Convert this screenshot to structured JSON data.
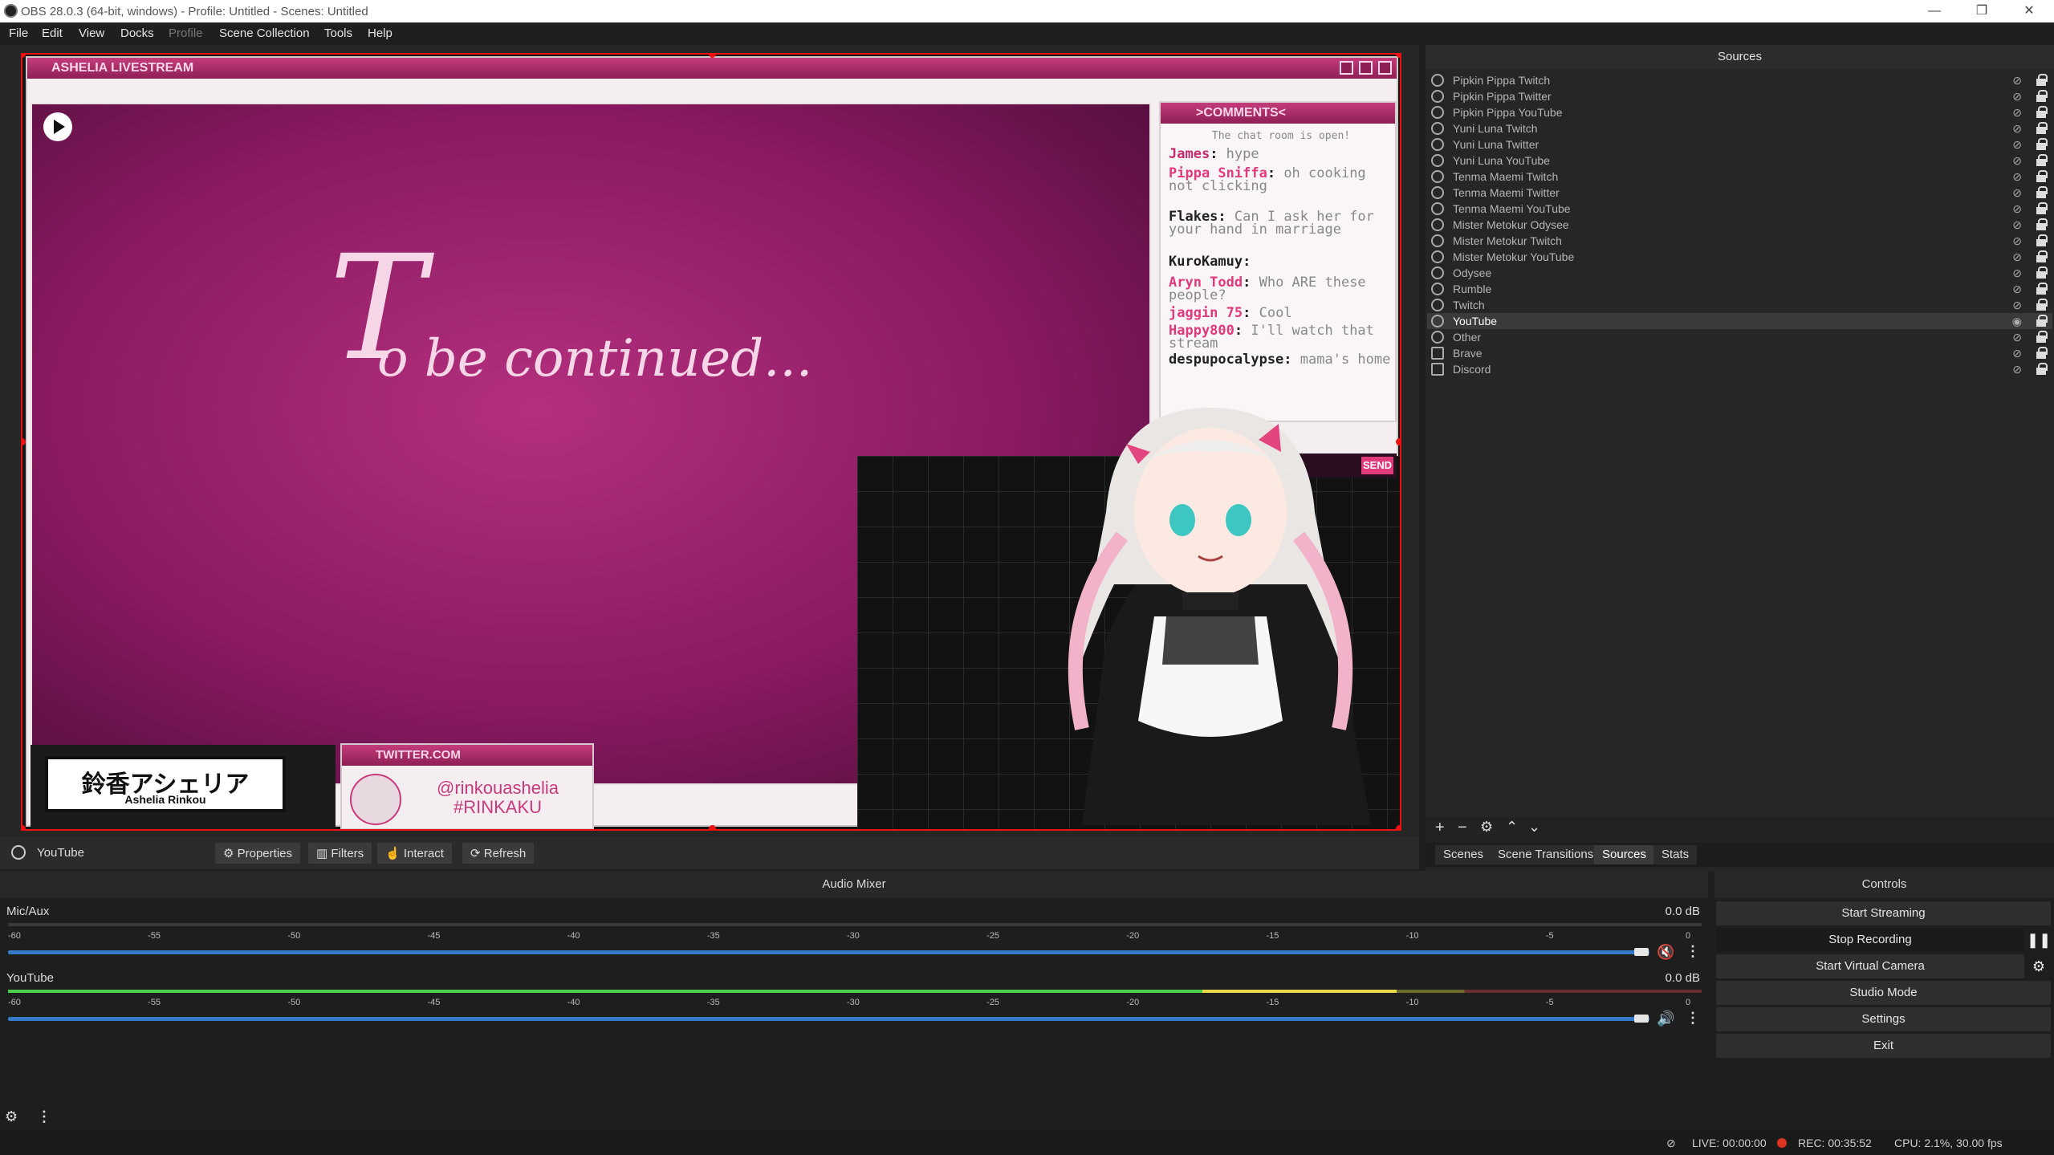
{
  "window": {
    "title": "OBS 28.0.3 (64-bit, windows) - Profile: Untitled - Scenes: Untitled",
    "minimize": "—",
    "maximize": "❐",
    "close": "✕"
  },
  "menu": [
    "File",
    "Edit",
    "View",
    "Docks",
    "Profile",
    "Scene Collection",
    "Tools",
    "Help"
  ],
  "preview": {
    "stream_title": "ASHELIA LIVESTREAM",
    "to_be_continued": "o be continued...",
    "big_letter": "T",
    "comments_title": ">COMMENTS<",
    "comments_notice": "The chat room is open!",
    "comments": [
      {
        "user": "James",
        "text": "hype"
      },
      {
        "user": "Pippa Sniffa",
        "text": "oh cooking not clicking"
      },
      {
        "user": "Flakes",
        "text": "Can I ask her for your hand in marriage"
      },
      {
        "user": "KuroKamuy",
        "text": ""
      },
      {
        "user": "Aryn Todd",
        "text": "Who ARE these people?"
      },
      {
        "user": "jaggin 75",
        "text": "Cool"
      },
      {
        "user": "Happy800",
        "text": "I'll watch that stream"
      },
      {
        "user": "despupocalypse",
        "text": "mama's home"
      }
    ],
    "send_label": "SEND",
    "logo_text": "鈴香アシェリア",
    "logo_sub": "Ashelia Rinkou",
    "twitter_title": "TWITTER.COM",
    "twitter_handle": "@rinkouashelia",
    "twitter_tag": "#RINKAKU"
  },
  "source_toolbar": {
    "selected_source": "YouTube",
    "properties": "Properties",
    "filters": "Filters",
    "interact": "Interact",
    "refresh": "Refresh"
  },
  "sources": {
    "title": "Sources",
    "items": [
      {
        "label": "Pipkin Pippa Twitch",
        "type": "browser"
      },
      {
        "label": "Pipkin Pippa Twitter",
        "type": "browser"
      },
      {
        "label": "Pipkin Pippa YouTube",
        "type": "browser"
      },
      {
        "label": "Yuni Luna Twitch",
        "type": "browser"
      },
      {
        "label": "Yuni Luna Twitter",
        "type": "browser"
      },
      {
        "label": "Yuni Luna YouTube",
        "type": "browser"
      },
      {
        "label": "Tenma Maemi Twitch",
        "type": "browser"
      },
      {
        "label": "Tenma Maemi Twitter",
        "type": "browser"
      },
      {
        "label": "Tenma Maemi YouTube",
        "type": "browser"
      },
      {
        "label": "Mister Metokur Odysee",
        "type": "browser"
      },
      {
        "label": "Mister Metokur Twitch",
        "type": "browser"
      },
      {
        "label": "Mister Metokur YouTube",
        "type": "browser"
      },
      {
        "label": "Odysee",
        "type": "browser"
      },
      {
        "label": "Rumble",
        "type": "browser"
      },
      {
        "label": "Twitch",
        "type": "browser"
      },
      {
        "label": "YouTube",
        "type": "browser",
        "selected": true,
        "visible": true
      },
      {
        "label": "Other",
        "type": "browser"
      },
      {
        "label": "Brave",
        "type": "window"
      },
      {
        "label": "Discord",
        "type": "window"
      }
    ]
  },
  "dock_tabs": [
    "Scenes",
    "Scene Transitions",
    "Sources",
    "Stats"
  ],
  "active_tab": "Sources",
  "mixer": {
    "title": "Audio Mixer",
    "ticks": [
      "-60",
      "-55",
      "-50",
      "-45",
      "-40",
      "-35",
      "-30",
      "-25",
      "-20",
      "-15",
      "-10",
      "-5",
      "0"
    ],
    "channels": [
      {
        "name": "Mic/Aux",
        "db": "0.0 dB",
        "muted": true,
        "level": 0.0
      },
      {
        "name": "YouTube",
        "db": "0.0 dB",
        "muted": false,
        "level": 0.82
      }
    ]
  },
  "controls": {
    "title": "Controls",
    "start_streaming": "Start Streaming",
    "stop_recording": "Stop Recording",
    "start_virtual_camera": "Start Virtual Camera",
    "studio_mode": "Studio Mode",
    "settings": "Settings",
    "exit": "Exit"
  },
  "status": {
    "live": "LIVE: 00:00:00",
    "rec": "REC: 00:35:52",
    "cpu": "CPU: 2.1%, 30.00 fps"
  },
  "colors": {
    "accent_red": "#e11111",
    "slider_blue": "#3478c8",
    "meter_green": "#4bd04b",
    "stream_magenta": "#8a1a62"
  }
}
